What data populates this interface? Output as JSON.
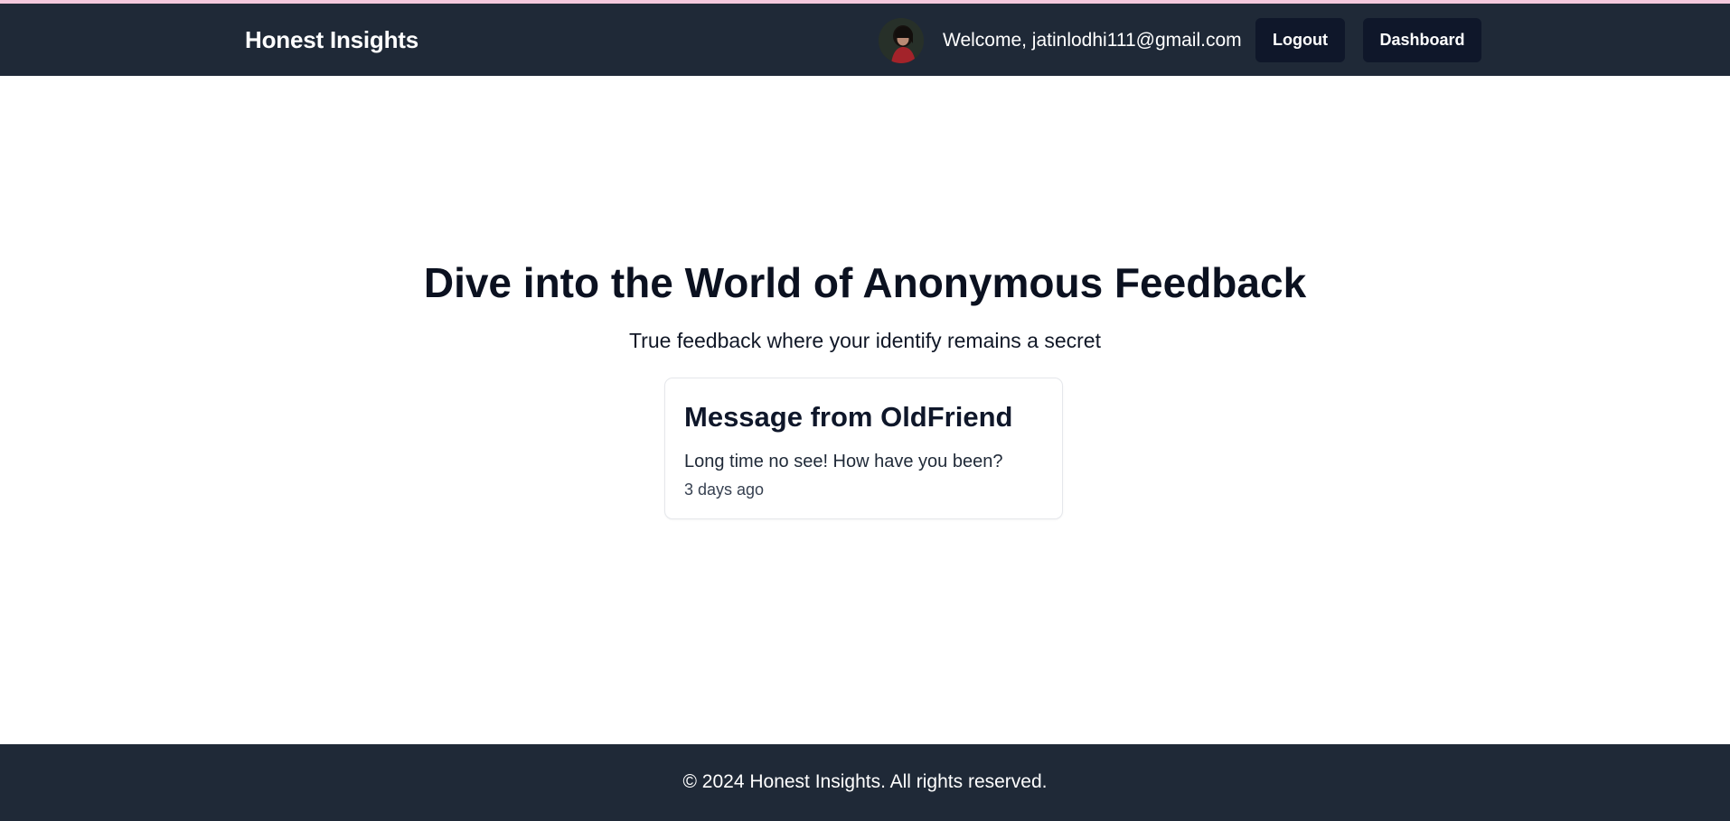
{
  "theme": {
    "navbar_bg": "#1f2937",
    "button_bg": "#0f172a",
    "accent_line": "#f3c8dc",
    "heading_color": "#0b1120"
  },
  "header": {
    "brand": "Honest Insights",
    "avatar_icon": "user-avatar-photo",
    "welcome_text": "Welcome, jatinlodhi111@gmail.com",
    "logout_label": "Logout",
    "dashboard_label": "Dashboard"
  },
  "hero": {
    "title": "Dive into the World of Anonymous Feedback",
    "subtitle": "True feedback where your identify remains a secret"
  },
  "message_card": {
    "title": "Message from OldFriend",
    "content": "Long time no see! How have you been?",
    "received": "3 days ago"
  },
  "footer": {
    "text": "© 2024 Honest Insights. All rights reserved."
  }
}
